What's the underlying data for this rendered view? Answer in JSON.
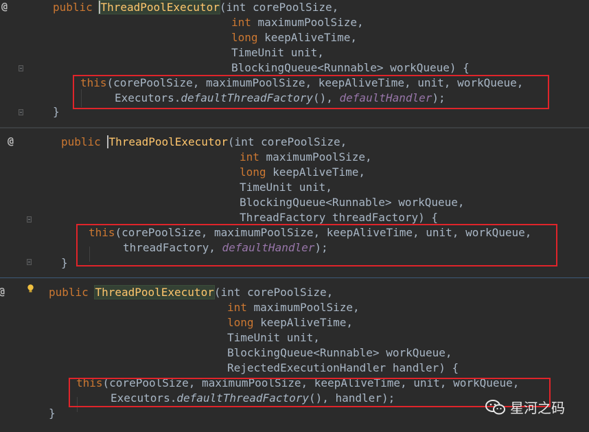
{
  "gutter": {
    "annotation": "@"
  },
  "panels": [
    {
      "lines": [
        [
          "public",
          "ThreadPoolExecutor",
          "(int corePoolSize,"
        ],
        [
          "int",
          "maximumPoolSize,"
        ],
        [
          "long",
          "keepAliveTime,"
        ],
        [
          "TimeUnit unit,"
        ],
        [
          "BlockingQueue<Runnable> workQueue) {"
        ],
        [
          "this",
          "(corePoolSize, maximumPoolSize, keepAliveTime, unit, workQueue,"
        ],
        [
          "Executors.",
          "defaultThreadFactory",
          "(),",
          "defaultHandler",
          ");"
        ],
        [
          "}"
        ]
      ]
    },
    {
      "lines": [
        [
          "public",
          "ThreadPoolExecutor",
          "(int corePoolSize,"
        ],
        [
          "int",
          "maximumPoolSize,"
        ],
        [
          "long",
          "keepAliveTime,"
        ],
        [
          "TimeUnit unit,"
        ],
        [
          "BlockingQueue<Runnable> workQueue,"
        ],
        [
          "ThreadFactory threadFactory) {"
        ],
        [
          "this",
          "(corePoolSize, maximumPoolSize, keepAliveTime, unit, workQueue,"
        ],
        [
          "threadFactory,",
          "defaultHandler",
          ");"
        ],
        [
          "}"
        ]
      ]
    },
    {
      "lines": [
        [
          "public",
          "ThreadPoolExecutor",
          "(int corePoolSize,"
        ],
        [
          "int",
          "maximumPoolSize,"
        ],
        [
          "long",
          "keepAliveTime,"
        ],
        [
          "TimeUnit unit,"
        ],
        [
          "BlockingQueue<Runnable> workQueue,"
        ],
        [
          "RejectedExecutionHandler handler) {"
        ],
        [
          "this",
          "(corePoolSize, maximumPoolSize, keepAliveTime, unit, workQueue,"
        ],
        [
          "Executors.",
          "defaultThreadFactory",
          "(), handler);"
        ],
        [
          "}"
        ]
      ]
    }
  ],
  "watermark": {
    "text": "星河之码",
    "icon": "wechat-icon"
  },
  "colors": {
    "keyword": "#cc7832",
    "method": "#ffc66d",
    "field": "#9876aa",
    "text": "#a9b7c6",
    "background": "#2b2b2b",
    "highlight_box": "#e0242a"
  }
}
